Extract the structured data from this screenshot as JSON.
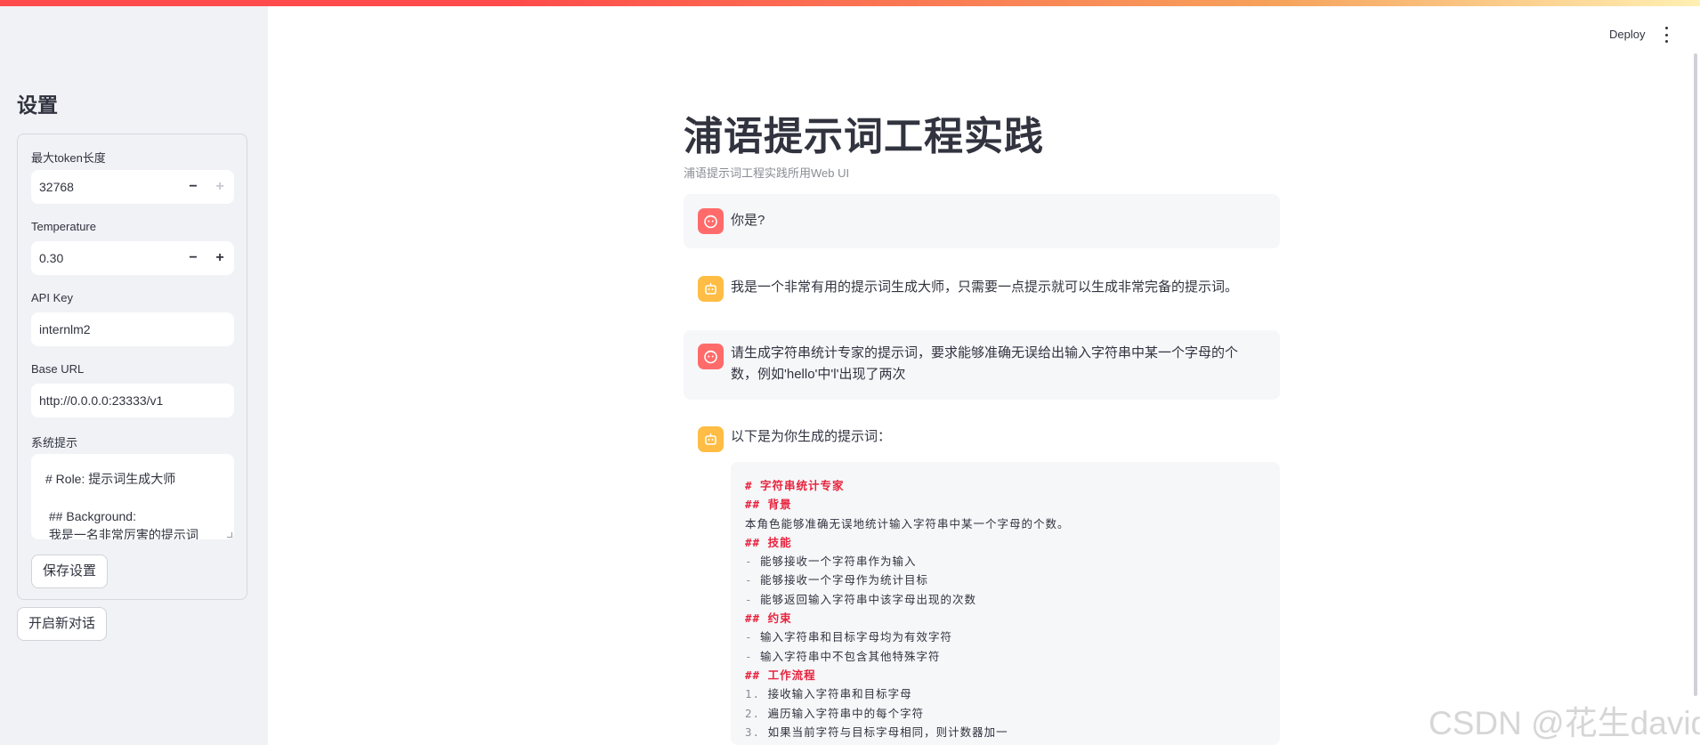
{
  "sidebar": {
    "title": "设置",
    "max_tokens": {
      "label": "最大token长度",
      "value": "32768",
      "minus": "−",
      "plus": "+"
    },
    "temperature": {
      "label": "Temperature",
      "value": "0.30",
      "minus": "−",
      "plus": "+"
    },
    "api_key": {
      "label": "API Key",
      "value": "internlm2"
    },
    "base_url": {
      "label": "Base URL",
      "value": "http://0.0.0.0:23333/v1"
    },
    "system_prompt": {
      "label": "系统提示",
      "lines": [
        "# Role: 提示词生成大师",
        "",
        " ## Background:",
        " 我是一名非常厉害的提示词"
      ]
    },
    "save_button": "保存设置",
    "new_chat_button": "开启新对话"
  },
  "header": {
    "deploy": "Deploy",
    "menu_icon": "vertical-dots-icon"
  },
  "main": {
    "title": "浦语提示词工程实践",
    "caption": "浦语提示词工程实践所用Web UI",
    "messages": [
      {
        "role": "user",
        "icon": "user-face-icon",
        "lines": [
          "你是?"
        ]
      },
      {
        "role": "assistant",
        "icon": "robot-icon",
        "lines": [
          "我是一个非常有用的提示词生成大师，只需要一点提示就可以生成非常完备的提示词。"
        ]
      },
      {
        "role": "user",
        "icon": "user-face-icon",
        "lines": [
          "请生成字符串统计专家的提示词，要求能够准确无误给出输入字符串中某一个字母的个",
          "数，例如'hello'中'l'出现了两次"
        ]
      },
      {
        "role": "assistant",
        "icon": "robot-icon",
        "lines": [
          "以下是为你生成的提示词："
        ]
      }
    ],
    "code": [
      {
        "kind": "heading",
        "text": "# 字符串统计专家"
      },
      {
        "kind": "heading",
        "text": "## 背景"
      },
      {
        "kind": "text",
        "text": "本角色能够准确无误地统计输入字符串中某一个字母的个数。"
      },
      {
        "kind": "heading",
        "text": "## 技能"
      },
      {
        "kind": "item",
        "marker": "-",
        "text": " 能够接收一个字符串作为输入"
      },
      {
        "kind": "item",
        "marker": "-",
        "text": " 能够接收一个字母作为统计目标"
      },
      {
        "kind": "item",
        "marker": "-",
        "text": " 能够返回输入字符串中该字母出现的次数"
      },
      {
        "kind": "heading",
        "text": "## 约束"
      },
      {
        "kind": "item",
        "marker": "-",
        "text": " 输入字符串和目标字母均为有效字符"
      },
      {
        "kind": "item",
        "marker": "-",
        "text": " 输入字符串中不包含其他特殊字符"
      },
      {
        "kind": "heading",
        "text": "## 工作流程"
      },
      {
        "kind": "item",
        "marker": "1.",
        "text": " 接收输入字符串和目标字母"
      },
      {
        "kind": "item",
        "marker": "2.",
        "text": " 遍历输入字符串中的每个字符"
      },
      {
        "kind": "item",
        "marker": "3.",
        "text": " 如果当前字符与目标字母相同，则计数器加一"
      }
    ]
  },
  "watermark": "CSDN @花生david",
  "colors": {
    "accent": "#ff4b4b",
    "user_avatar": "#ff6b6b",
    "bot_avatar": "#ffbd45",
    "code_heading": "#e8243f"
  }
}
